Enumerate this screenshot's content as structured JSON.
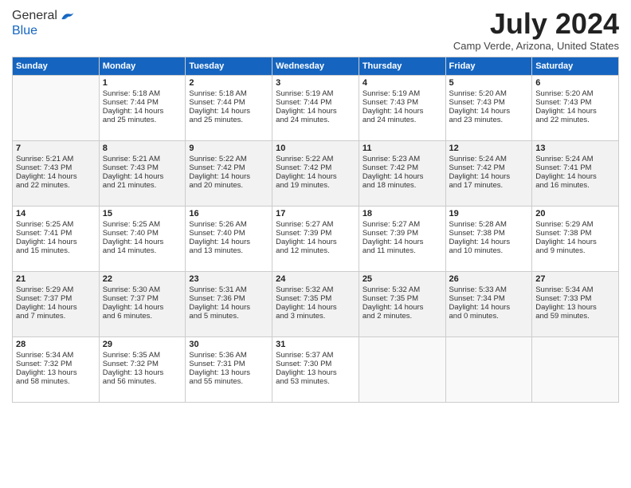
{
  "logo": {
    "general": "General",
    "blue": "Blue"
  },
  "header": {
    "month_year": "July 2024",
    "location": "Camp Verde, Arizona, United States"
  },
  "days_of_week": [
    "Sunday",
    "Monday",
    "Tuesday",
    "Wednesday",
    "Thursday",
    "Friday",
    "Saturday"
  ],
  "weeks": [
    [
      {
        "day": null,
        "data": null
      },
      {
        "day": "1",
        "data": "Sunrise: 5:18 AM\nSunset: 7:44 PM\nDaylight: 14 hours\nand 25 minutes."
      },
      {
        "day": "2",
        "data": "Sunrise: 5:18 AM\nSunset: 7:44 PM\nDaylight: 14 hours\nand 25 minutes."
      },
      {
        "day": "3",
        "data": "Sunrise: 5:19 AM\nSunset: 7:44 PM\nDaylight: 14 hours\nand 24 minutes."
      },
      {
        "day": "4",
        "data": "Sunrise: 5:19 AM\nSunset: 7:43 PM\nDaylight: 14 hours\nand 24 minutes."
      },
      {
        "day": "5",
        "data": "Sunrise: 5:20 AM\nSunset: 7:43 PM\nDaylight: 14 hours\nand 23 minutes."
      },
      {
        "day": "6",
        "data": "Sunrise: 5:20 AM\nSunset: 7:43 PM\nDaylight: 14 hours\nand 22 minutes."
      }
    ],
    [
      {
        "day": "7",
        "data": "Sunrise: 5:21 AM\nSunset: 7:43 PM\nDaylight: 14 hours\nand 22 minutes."
      },
      {
        "day": "8",
        "data": "Sunrise: 5:21 AM\nSunset: 7:43 PM\nDaylight: 14 hours\nand 21 minutes."
      },
      {
        "day": "9",
        "data": "Sunrise: 5:22 AM\nSunset: 7:42 PM\nDaylight: 14 hours\nand 20 minutes."
      },
      {
        "day": "10",
        "data": "Sunrise: 5:22 AM\nSunset: 7:42 PM\nDaylight: 14 hours\nand 19 minutes."
      },
      {
        "day": "11",
        "data": "Sunrise: 5:23 AM\nSunset: 7:42 PM\nDaylight: 14 hours\nand 18 minutes."
      },
      {
        "day": "12",
        "data": "Sunrise: 5:24 AM\nSunset: 7:42 PM\nDaylight: 14 hours\nand 17 minutes."
      },
      {
        "day": "13",
        "data": "Sunrise: 5:24 AM\nSunset: 7:41 PM\nDaylight: 14 hours\nand 16 minutes."
      }
    ],
    [
      {
        "day": "14",
        "data": "Sunrise: 5:25 AM\nSunset: 7:41 PM\nDaylight: 14 hours\nand 15 minutes."
      },
      {
        "day": "15",
        "data": "Sunrise: 5:25 AM\nSunset: 7:40 PM\nDaylight: 14 hours\nand 14 minutes."
      },
      {
        "day": "16",
        "data": "Sunrise: 5:26 AM\nSunset: 7:40 PM\nDaylight: 14 hours\nand 13 minutes."
      },
      {
        "day": "17",
        "data": "Sunrise: 5:27 AM\nSunset: 7:39 PM\nDaylight: 14 hours\nand 12 minutes."
      },
      {
        "day": "18",
        "data": "Sunrise: 5:27 AM\nSunset: 7:39 PM\nDaylight: 14 hours\nand 11 minutes."
      },
      {
        "day": "19",
        "data": "Sunrise: 5:28 AM\nSunset: 7:38 PM\nDaylight: 14 hours\nand 10 minutes."
      },
      {
        "day": "20",
        "data": "Sunrise: 5:29 AM\nSunset: 7:38 PM\nDaylight: 14 hours\nand 9 minutes."
      }
    ],
    [
      {
        "day": "21",
        "data": "Sunrise: 5:29 AM\nSunset: 7:37 PM\nDaylight: 14 hours\nand 7 minutes."
      },
      {
        "day": "22",
        "data": "Sunrise: 5:30 AM\nSunset: 7:37 PM\nDaylight: 14 hours\nand 6 minutes."
      },
      {
        "day": "23",
        "data": "Sunrise: 5:31 AM\nSunset: 7:36 PM\nDaylight: 14 hours\nand 5 minutes."
      },
      {
        "day": "24",
        "data": "Sunrise: 5:32 AM\nSunset: 7:35 PM\nDaylight: 14 hours\nand 3 minutes."
      },
      {
        "day": "25",
        "data": "Sunrise: 5:32 AM\nSunset: 7:35 PM\nDaylight: 14 hours\nand 2 minutes."
      },
      {
        "day": "26",
        "data": "Sunrise: 5:33 AM\nSunset: 7:34 PM\nDaylight: 14 hours\nand 0 minutes."
      },
      {
        "day": "27",
        "data": "Sunrise: 5:34 AM\nSunset: 7:33 PM\nDaylight: 13 hours\nand 59 minutes."
      }
    ],
    [
      {
        "day": "28",
        "data": "Sunrise: 5:34 AM\nSunset: 7:32 PM\nDaylight: 13 hours\nand 58 minutes."
      },
      {
        "day": "29",
        "data": "Sunrise: 5:35 AM\nSunset: 7:32 PM\nDaylight: 13 hours\nand 56 minutes."
      },
      {
        "day": "30",
        "data": "Sunrise: 5:36 AM\nSunset: 7:31 PM\nDaylight: 13 hours\nand 55 minutes."
      },
      {
        "day": "31",
        "data": "Sunrise: 5:37 AM\nSunset: 7:30 PM\nDaylight: 13 hours\nand 53 minutes."
      },
      {
        "day": null,
        "data": null
      },
      {
        "day": null,
        "data": null
      },
      {
        "day": null,
        "data": null
      }
    ]
  ]
}
